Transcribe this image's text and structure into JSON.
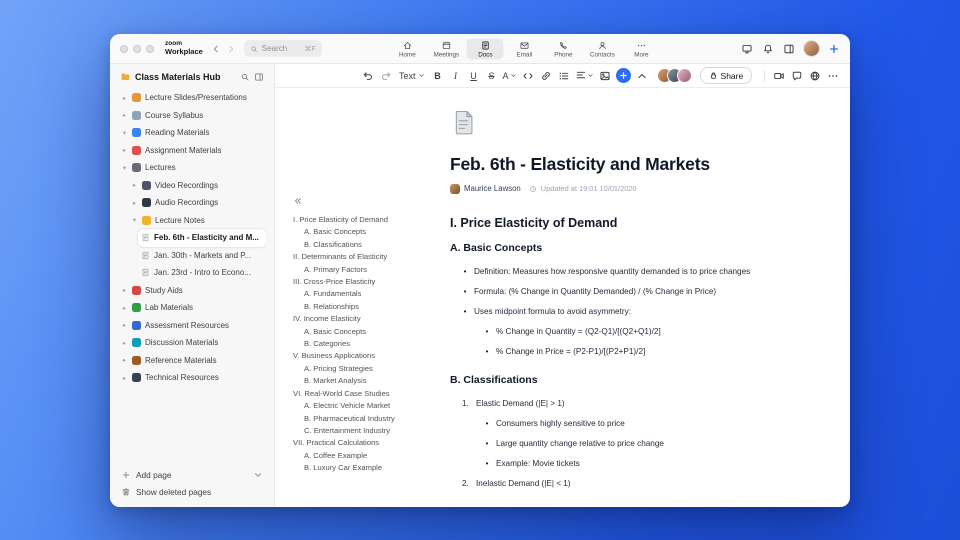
{
  "colors": {
    "accent": "#2c6ef2"
  },
  "titlebar": {
    "brand_top": "zoom",
    "brand_bottom": "Workplace",
    "search": {
      "placeholder": "Search",
      "shortcut": "⌘F"
    },
    "tabs": [
      {
        "label": "Home",
        "icon": "home",
        "active": false
      },
      {
        "label": "Meetings",
        "icon": "calendar",
        "active": false
      },
      {
        "label": "Docs",
        "icon": "doc-lines",
        "active": true
      },
      {
        "label": "Email",
        "icon": "mail",
        "active": false
      },
      {
        "label": "Phone",
        "icon": "phone",
        "active": false
      },
      {
        "label": "Contacts",
        "icon": "contacts",
        "active": false
      },
      {
        "label": "More",
        "icon": "dots-h",
        "active": false
      }
    ]
  },
  "sidebar": {
    "title": "Class Materials Hub",
    "tree": [
      {
        "level": 0,
        "chevron": "right",
        "icon": "bar-chart",
        "color": "#e8963a",
        "label": "Lecture Slides/Presentations"
      },
      {
        "level": 0,
        "chevron": "right",
        "icon": "clipboard",
        "color": "#8fa3b8",
        "label": "Course Syllabus"
      },
      {
        "level": 0,
        "chevron": "down",
        "icon": "open-book",
        "color": "#3b82f6",
        "label": "Reading Materials"
      },
      {
        "level": 0,
        "chevron": "right",
        "icon": "target",
        "color": "#e05252",
        "label": "Assignment Materials"
      },
      {
        "level": 0,
        "chevron": "down",
        "icon": "microphone",
        "color": "#6d6a75",
        "label": "Lectures"
      },
      {
        "level": 1,
        "chevron": "right",
        "icon": "video-camera",
        "color": "#4a5568",
        "label": "Video Recordings"
      },
      {
        "level": 1,
        "chevron": "right",
        "icon": "headphones",
        "color": "#2d3748",
        "label": "Audio Recordings"
      },
      {
        "level": 1,
        "chevron": "down",
        "icon": "memo",
        "color": "#f0b429",
        "label": "Lecture Notes"
      },
      {
        "level": 2,
        "chevron": "none",
        "icon": "page",
        "color": "#9ca3af",
        "label": "Feb. 6th - Elasticity and M...",
        "selected": true
      },
      {
        "level": 2,
        "chevron": "none",
        "icon": "page",
        "color": "#9ca3af",
        "label": "Jan. 30th - Markets and P..."
      },
      {
        "level": 2,
        "chevron": "none",
        "icon": "page",
        "color": "#9ca3af",
        "label": "Jan. 23rd - Intro to Econo..."
      },
      {
        "level": 0,
        "chevron": "right",
        "icon": "apple",
        "color": "#d64545",
        "label": "Study Aids"
      },
      {
        "level": 0,
        "chevron": "right",
        "icon": "lab-flask",
        "color": "#2f9e44",
        "label": "Lab Materials"
      },
      {
        "level": 0,
        "chevron": "right",
        "icon": "chart",
        "color": "#3567d6",
        "label": "Assessment Resources"
      },
      {
        "level": 0,
        "chevron": "right",
        "icon": "speech-bubble",
        "color": "#0e9db8",
        "label": "Discussion Materials"
      },
      {
        "level": 0,
        "chevron": "right",
        "icon": "books",
        "color": "#a05a2c",
        "label": "Reference Materials"
      },
      {
        "level": 0,
        "chevron": "right",
        "icon": "laptop",
        "color": "#374151",
        "label": "Technical Resources"
      }
    ],
    "footer": {
      "add_page": "Add page",
      "show_deleted": "Show deleted pages"
    }
  },
  "toolbar": {
    "text_style": "Text",
    "bold": "B",
    "italic": "I",
    "underline": "U",
    "strikethrough": "S",
    "color": "A",
    "share": "Share"
  },
  "doc": {
    "title": "Feb. 6th - Elasticity and Markets",
    "author": "Maurice Lawson",
    "updated": "Updated at 19:01 10/01/2020",
    "outline": [
      {
        "l": 1,
        "t": "I. Price Elasticity of Demand"
      },
      {
        "l": 2,
        "t": "A. Basic Concepts"
      },
      {
        "l": 2,
        "t": "B. Classifications"
      },
      {
        "l": 1,
        "t": "II. Determinants of Elasticity"
      },
      {
        "l": 2,
        "t": "A. Primary Factors"
      },
      {
        "l": 1,
        "t": "III. Cross-Price Elasticity"
      },
      {
        "l": 2,
        "t": "A. Fundamentals"
      },
      {
        "l": 2,
        "t": "B. Relationships"
      },
      {
        "l": 1,
        "t": "IV. Income Elasticity"
      },
      {
        "l": 2,
        "t": "A. Basic Concepts"
      },
      {
        "l": 2,
        "t": "B. Categories"
      },
      {
        "l": 1,
        "t": "V. Business Applications"
      },
      {
        "l": 2,
        "t": "A. Pricing Strategies"
      },
      {
        "l": 2,
        "t": "B. Market Analysis"
      },
      {
        "l": 1,
        "t": "VI. Real-World Case Studies"
      },
      {
        "l": 2,
        "t": "A. Electric Vehicle Market"
      },
      {
        "l": 2,
        "t": "B. Pharmaceutical Industry"
      },
      {
        "l": 2,
        "t": "C. Entertainment Industry"
      },
      {
        "l": 1,
        "t": "VII. Practical Calculations"
      },
      {
        "l": 2,
        "t": "A. Coffee Example"
      },
      {
        "l": 2,
        "t": "B. Luxury Car Example"
      }
    ],
    "blocks": [
      {
        "t": "h2",
        "text": "I. Price Elasticity of Demand"
      },
      {
        "t": "h3",
        "text": "A. Basic Concepts"
      },
      {
        "t": "b1",
        "text": "Definition: Measures how responsive quantity demanded is to price changes"
      },
      {
        "t": "b1",
        "text": "Formula: (% Change in Quantity Demanded) / (% Change in Price)"
      },
      {
        "t": "b1",
        "text": "Uses midpoint formula to avoid asymmetry:"
      },
      {
        "t": "b2",
        "text": "% Change in Quantity = (Q2-Q1)/[(Q2+Q1)/2]"
      },
      {
        "t": "b2",
        "text": "% Change in Price = (P2-P1)/[(P2+P1)/2]"
      },
      {
        "t": "h3",
        "text": "B. Classifications"
      },
      {
        "t": "n1",
        "num": "1.",
        "text": "Elastic Demand (|E| > 1)"
      },
      {
        "t": "b2",
        "text": "Consumers highly sensitive to price"
      },
      {
        "t": "b2",
        "text": "Large quantity change relative to price change"
      },
      {
        "t": "b2",
        "text": "Example: Movie tickets"
      },
      {
        "t": "n1",
        "num": "2.",
        "text": "Inelastic Demand (|E| < 1)"
      }
    ]
  }
}
